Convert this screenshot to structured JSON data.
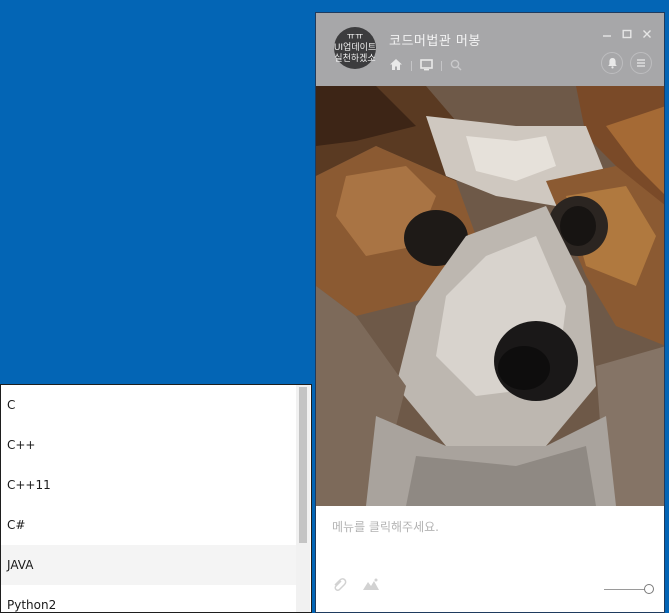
{
  "chat": {
    "avatar_lines": [
      "ㅠㅠ",
      "UI업데이트",
      "실천하겠소"
    ],
    "title": "코드머법관 머봉",
    "placeholder": "메뉴를 클릭해주세요.",
    "icons": {
      "home": "home-icon",
      "monitor": "monitor-icon",
      "search": "search-icon",
      "bell": "bell-icon",
      "menu": "menu-icon",
      "attach": "paperclip-icon",
      "image": "image-icon",
      "minimize": "minimize-icon",
      "maximize": "maximize-icon",
      "close": "close-icon"
    }
  },
  "languages": {
    "items": [
      "C",
      "C++",
      "C++11",
      "C#",
      "JAVA",
      "Python2"
    ],
    "highlighted_index": 4
  },
  "colors": {
    "desktop": "#0365b5",
    "header": "#a7a7a9"
  }
}
